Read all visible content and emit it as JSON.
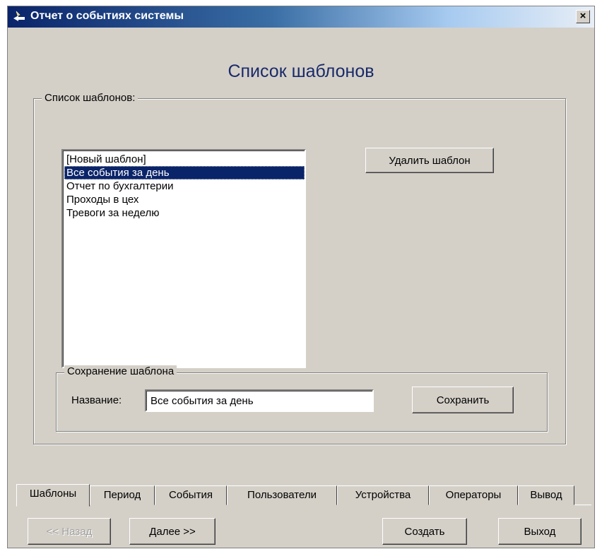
{
  "window": {
    "title": "Отчет о событиях системы",
    "close_glyph": "×",
    "icon": "report-wizard-icon"
  },
  "page_title": "Список шаблонов",
  "templates_group": {
    "label": "Список шаблонов:",
    "items": [
      "[Новый шаблон]",
      "Все события за день",
      "Отчет по бухгалтерии",
      "Проходы в цех",
      "Тревоги за неделю"
    ],
    "selected_index": 1,
    "delete_button": "Удалить шаблон"
  },
  "save_group": {
    "label": "Сохранение шаблона",
    "name_label": "Название:",
    "name_value": "Все события за день",
    "save_button": "Сохранить"
  },
  "tabs": [
    "Шаблоны",
    "Период",
    "События",
    "Пользователи",
    "Устройства",
    "Операторы",
    "Вывод"
  ],
  "active_tab": 0,
  "footer": {
    "back": "<< Назад",
    "next": "Далее >>",
    "create": "Создать",
    "exit": "Выход"
  },
  "colors": {
    "face": "#d4d0c8",
    "title_start": "#0a246a",
    "selection": "#0a246a",
    "heading": "#1a2a6a"
  }
}
